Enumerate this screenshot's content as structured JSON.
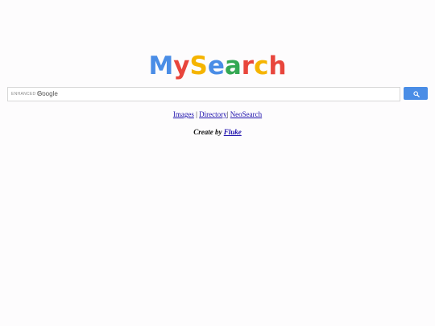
{
  "logo": {
    "letters": [
      {
        "char": "M",
        "color": "#4a8de6"
      },
      {
        "char": "y",
        "color": "#e8453c"
      },
      {
        "char": "S",
        "color": "#f5b400"
      },
      {
        "char": "e",
        "color": "#4a8de6"
      },
      {
        "char": "a",
        "color": "#34a853"
      },
      {
        "char": "r",
        "color": "#e8453c"
      },
      {
        "char": "c",
        "color": "#f5b400"
      },
      {
        "char": "h",
        "color": "#e8453c"
      }
    ]
  },
  "search": {
    "enhanced_label": "ENHANCED BY",
    "brand_label": "Google",
    "value": "",
    "button_icon": "search-icon",
    "button_color": "#4a8de6"
  },
  "links": {
    "images": "Images",
    "sep1": "|",
    "directory": "Directory",
    "sep2": "|",
    "neosearch": "NeoSearch"
  },
  "credit": {
    "prefix": "Create by",
    "author": "Fluke"
  }
}
